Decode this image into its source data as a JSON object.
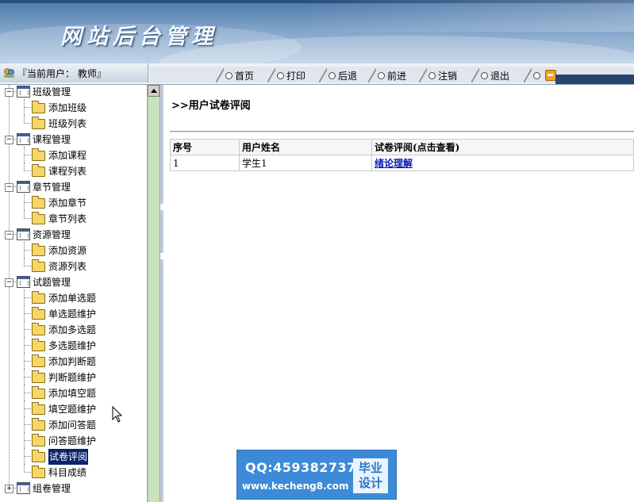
{
  "banner": {
    "title": "网站后台管理"
  },
  "user": {
    "label": "『当前用户： 教师』"
  },
  "nav": {
    "items": [
      {
        "key": "home",
        "label": "首页"
      },
      {
        "key": "print",
        "label": "打印"
      },
      {
        "key": "back",
        "label": "后退"
      },
      {
        "key": "forward",
        "label": "前进"
      },
      {
        "key": "logout",
        "label": "注销"
      },
      {
        "key": "exit",
        "label": "退出"
      }
    ]
  },
  "sidebar": {
    "groups": [
      {
        "label": "班级管理",
        "children": [
          "添加班级",
          "班级列表"
        ]
      },
      {
        "label": "课程管理",
        "children": [
          "添加课程",
          "课程列表"
        ]
      },
      {
        "label": "章节管理",
        "children": [
          "添加章节",
          "章节列表"
        ]
      },
      {
        "label": "资源管理",
        "children": [
          "添加资源",
          "资源列表"
        ]
      },
      {
        "label": "试题管理",
        "children": [
          "添加单选题",
          "单选题维护",
          "添加多选题",
          "多选题维护",
          "添加判断题",
          "判断题维护",
          "添加填空题",
          "填空题维护",
          "添加问答题",
          "问答题维护",
          "试卷评阅",
          "科目成绩"
        ]
      },
      {
        "label": "组卷管理",
        "children": []
      }
    ],
    "selected": "试卷评阅"
  },
  "main": {
    "heading": ">>用户试卷评阅",
    "table": {
      "headers": [
        "序号",
        "用户姓名",
        "试卷评阅(点击查看)"
      ],
      "rows": [
        [
          "1",
          "学生1",
          "绪论理解"
        ]
      ]
    }
  },
  "watermark": {
    "qq": "QQ:459382737",
    "site": "www.kecheng8.com",
    "seal_line1": "毕业",
    "seal_line2": "设计"
  }
}
